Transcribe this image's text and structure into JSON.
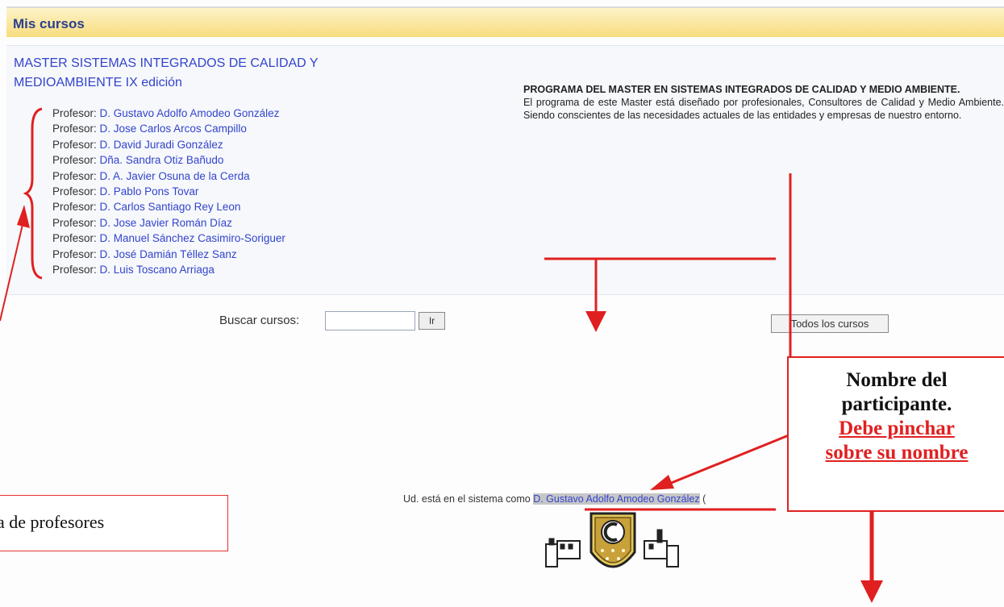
{
  "header": {
    "title": "Mis cursos"
  },
  "course": {
    "title": "MASTER SISTEMAS INTEGRADOS DE CALIDAD Y MEDIOAMBIENTE IX edición",
    "teacher_prefix": "Profesor:",
    "teachers": [
      "D. Gustavo Adolfo Amodeo González",
      "D. Jose Carlos Arcos Campillo",
      "D. David Juradi González",
      "Dña. Sandra Otiz Bañudo",
      "D. A. Javier Osuna de la Cerda",
      "D. Pablo Pons Tovar",
      "D. Carlos Santiago Rey Leon",
      "D. Jose Javier Román Díaz",
      "D. Manuel Sánchez Casimiro-Soriguer",
      "D. José Damián Téllez Sanz",
      "D. Luis Toscano Arriaga"
    ],
    "summary_title": "PROGRAMA DEL MASTER EN SISTEMAS INTEGRADOS DE CALIDAD Y MEDIO AMBIENTE.",
    "summary_text": "El programa de este Master está diseñado por profesionales, Consultores de Calidad y Medio Ambiente. Siendo conscientes de las necesidades actuales de las entidades y empresas de nuestro entorno."
  },
  "search": {
    "label": "Buscar cursos:",
    "value": "",
    "button_label": "Ir"
  },
  "all_courses_label": "Todos los cursos",
  "login": {
    "prefix": "Ud. está en el sistema como",
    "user": "D. Gustavo Adolfo Amodeo González",
    "suffix": "("
  },
  "callouts": {
    "teachers_list": "a de profesores",
    "participant_line1": "Nombre del",
    "participant_line2": "participante.",
    "participant_link1": "Debe pinchar",
    "participant_link2": "sobre su nombre"
  },
  "colors": {
    "annotation_red": "#e02020",
    "link_blue": "#3344cc",
    "header_gold": "#f8dc7e"
  }
}
